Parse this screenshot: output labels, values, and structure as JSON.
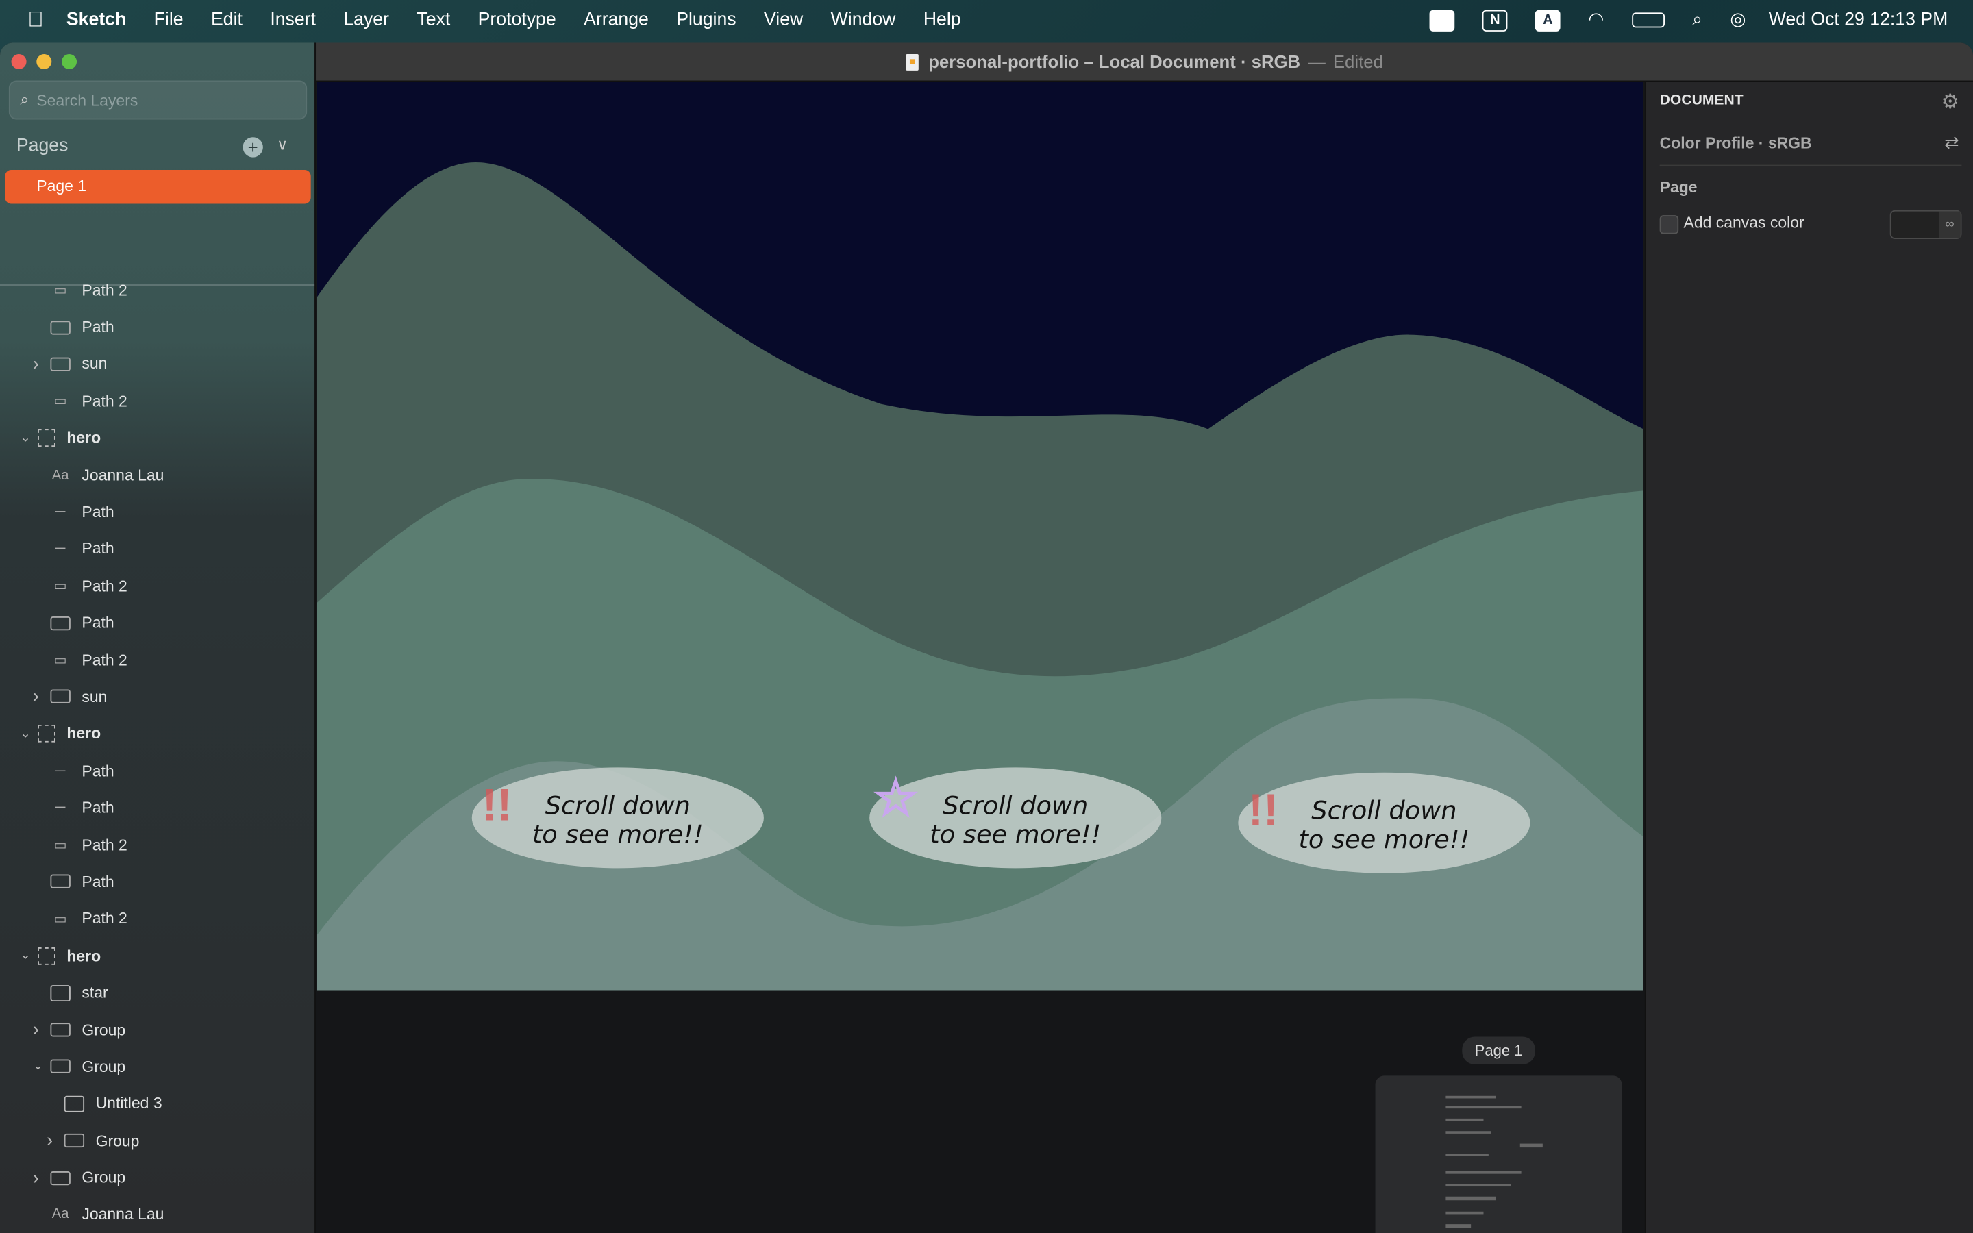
{
  "menubar": {
    "app": "Sketch",
    "items": [
      "File",
      "Edit",
      "Insert",
      "Layer",
      "Text",
      "Prototype",
      "Arrange",
      "Plugins",
      "View",
      "Window",
      "Help"
    ],
    "clock": "Wed Oct 29  12:13 PM",
    "status_icons": [
      "window-icon",
      "notion-icon",
      "input-source-icon",
      "wifi-icon",
      "battery-icon",
      "spotlight-icon",
      "control-center-icon"
    ],
    "notion_glyph": "N",
    "input_glyph": "A"
  },
  "window": {
    "title": "personal-portfolio – Local Document · sRGB",
    "title_sep": "—",
    "edited": "Edited"
  },
  "sidebar": {
    "search_placeholder": "Search Layers",
    "pages_label": "Pages",
    "pages": [
      "Page 1"
    ],
    "layers": [
      {
        "label": "Path 2",
        "type": "shape",
        "indent": 1
      },
      {
        "label": "Path",
        "type": "folder",
        "indent": 1
      },
      {
        "label": "sun",
        "type": "folder",
        "indent": 1,
        "arrow": "right"
      },
      {
        "label": "Path 2",
        "type": "shape",
        "indent": 1
      },
      {
        "label": "hero",
        "type": "board",
        "indent": 0,
        "arrow": "down",
        "bold": true
      },
      {
        "label": "Joanna Lau",
        "type": "text",
        "indent": 1
      },
      {
        "label": "Path",
        "type": "line",
        "indent": 1
      },
      {
        "label": "Path",
        "type": "line",
        "indent": 1
      },
      {
        "label": "Path 2",
        "type": "shape",
        "indent": 1
      },
      {
        "label": "Path",
        "type": "folder",
        "indent": 1
      },
      {
        "label": "Path 2",
        "type": "shape",
        "indent": 1
      },
      {
        "label": "sun",
        "type": "folder",
        "indent": 1,
        "arrow": "right"
      },
      {
        "label": "hero",
        "type": "board",
        "indent": 0,
        "arrow": "down",
        "bold": true
      },
      {
        "label": "Path",
        "type": "line",
        "indent": 1
      },
      {
        "label": "Path",
        "type": "line",
        "indent": 1
      },
      {
        "label": "Path 2",
        "type": "shape",
        "indent": 1
      },
      {
        "label": "Path",
        "type": "folder",
        "indent": 1
      },
      {
        "label": "Path 2",
        "type": "shape",
        "indent": 1
      },
      {
        "label": "hero",
        "type": "board",
        "indent": 0,
        "arrow": "down",
        "bold": true
      },
      {
        "label": "star",
        "type": "image",
        "indent": 1
      },
      {
        "label": "Group",
        "type": "folder",
        "indent": 1,
        "arrow": "right"
      },
      {
        "label": "Group",
        "type": "folder",
        "indent": 1,
        "arrow": "down"
      },
      {
        "label": "Untitled 3",
        "type": "image",
        "indent": 2
      },
      {
        "label": "Group",
        "type": "folder",
        "indent": 2,
        "arrow": "right"
      },
      {
        "label": "Group",
        "type": "folder",
        "indent": 1,
        "arrow": "right"
      },
      {
        "label": "Joanna Lau",
        "type": "text",
        "indent": 1
      }
    ]
  },
  "canvas": {
    "bubbles": [
      {
        "line1": "Scroll down",
        "line2": "to see more!!",
        "deco": "exclamation"
      },
      {
        "line1": "Scroll down",
        "line2": "to see more!!",
        "deco": "star"
      },
      {
        "line1": "Scroll down",
        "line2": "to see more!!",
        "deco": "exclamation"
      }
    ],
    "colors": {
      "sky": "#070a2a",
      "back": "#475e57",
      "mid": "#5b7d71",
      "front": "#718c86",
      "bubble": "#c6cfcb"
    },
    "minimap_label": "Page 1"
  },
  "inspector": {
    "header": "DOCUMENT",
    "color_profile": "Color Profile · sRGB",
    "page_section": "Page",
    "canvas_color_label": "Add canvas color",
    "canvas_color_checked": false
  }
}
